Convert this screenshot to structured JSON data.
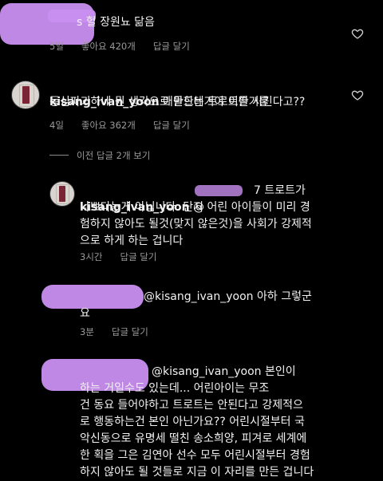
{
  "comment0": {
    "text": "s 헐 장원뇨 닮음",
    "time": "5일",
    "likes": "좋아요 420개",
    "reply": "답글 달기"
  },
  "comment1": {
    "username": "kisang_ivan_yoon",
    "text_line1": "애들한테 트로트를 시킨다고??",
    "text_line2": "동심파괴하네 뭔 생각으로 만드는거야 이딴거를",
    "time": "4일",
    "likes": "좋아요 362개",
    "reply": "답글 달기"
  },
  "view_replies": "이전 답글 2개 보기",
  "reply1": {
    "username": "kisang_ivan_yoon",
    "mention": "@",
    "text_first": "7 트로트가",
    "text_rest": "나쁘다는게 아닙니다. 단지 어린 아이들이 미리 경\n험하지 않아도 될것(맞지 않은것)을 사회가 강제적\n으로 하게 하는 겁니다",
    "time": "3시간",
    "reply": "답글 달기"
  },
  "reply2": {
    "text_line1": "@kisang_ivan_yoon 아하 그렇군",
    "text_line2": "요",
    "time": "3분",
    "reply": "답글 달기"
  },
  "reply3": {
    "text_line1": "@kisang_ivan_yoon 본인이",
    "text_rest": "하는 거일수도 있는데... 어린아이는 무조\n건 동요 들어야하고 트로트는 안된다고 강제적으\n로 행동하는건 본인 아닌가요?? 어린시절부터 국\n악신동으로 유명세 떨친 송소희양, 피겨로 세계에\n한 획을 그은 김연아 선수 모두 어린시절부터 경험\n하지 않아도 될 것들로 지금 이 자리를 만든 겁니다"
  },
  "colors": {
    "redaction": "#c88ff0",
    "background": "#000000"
  }
}
